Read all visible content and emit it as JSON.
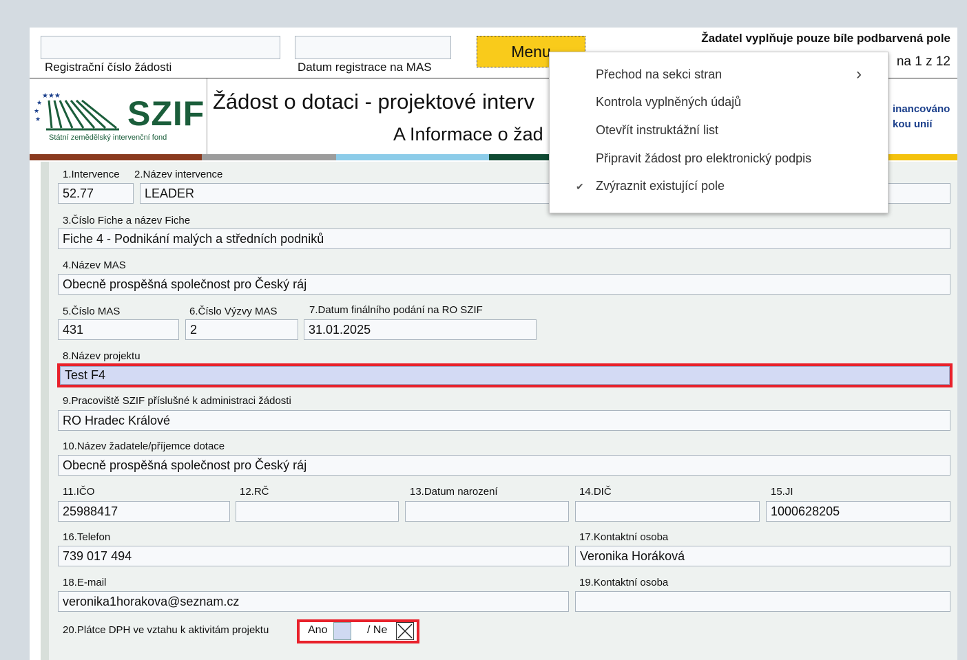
{
  "header": {
    "reg_number_label": "Registrační číslo žádosti",
    "reg_date_label": "Datum registrace na MAS",
    "menu_label": "Menu",
    "instruction": "Žadatel vyplňuje pouze bíle podbarvená pole",
    "page_info": "na 1 z 12",
    "logo_text": "SZIF",
    "logo_subtitle": "Státní zemědělský intervenční fond",
    "title": "Žádost o dotaci - projektové interv",
    "section_title": "A Informace o žad",
    "eu_line1": "inancováno",
    "eu_line2": "kou unií"
  },
  "menu": {
    "items": [
      {
        "label": "Přechod na sekci stran",
        "submenu_icon": "chevron-right"
      },
      {
        "label": "Kontrola vyplněných údajů"
      },
      {
        "label": "Otevřít instruktážní list"
      },
      {
        "label": "Připravit žádost pro elektronický podpis"
      },
      {
        "label": "Zvýraznit existující pole",
        "checked": true
      }
    ],
    "check_mark": "✔",
    "chevron": "›"
  },
  "form": {
    "f1_label": "1.Intervence",
    "f1_value": "52.77",
    "f2_label": "2.Název intervence",
    "f2_value": "LEADER",
    "f3_label": "3.Číslo Fiche a název Fiche",
    "f3_value": "Fiche 4 - Podnikání malých a středních podniků",
    "f4_label": "4.Název MAS",
    "f4_value": "Obecně prospěšná společnost pro Český ráj",
    "f5_label": "5.Číslo MAS",
    "f5_value": "431",
    "f6_label": "6.Číslo Výzvy MAS",
    "f6_value": "2",
    "f7_label": "7.Datum finálního podání na RO SZIF",
    "f7_value": "31.01.2025",
    "f8_label": "8.Název projektu",
    "f8_value": "Test F4",
    "f9_label": "9.Pracoviště SZIF příslušné k administraci žádosti",
    "f9_value": "RO Hradec Králové",
    "f10_label": "10.Název žadatele/příjemce dotace",
    "f10_value": "Obecně prospěšná společnost pro Český ráj",
    "f11_label": "11.IČO",
    "f11_value": "25988417",
    "f12_label": "12.RČ",
    "f12_value": "",
    "f13_label": "13.Datum narození",
    "f13_value": "",
    "f14_label": "14.DIČ",
    "f14_value": "",
    "f15_label": "15.JI",
    "f15_value": "1000628205",
    "f16_label": "16.Telefon",
    "f16_value": "739 017 494",
    "f17_label": "17.Kontaktní osoba",
    "f17_value": "Veronika Horáková",
    "f18_label": "18.E-mail",
    "f18_value": "veronika1horakova@seznam.cz",
    "f19_label": "19.Kontaktní osoba",
    "f19_value": "",
    "f20_label": "20.Plátce DPH ve vztahu k aktivitám projektu",
    "f20_yes": "Ano",
    "f20_no": "/ Ne"
  },
  "colors": {
    "highlight": "#e8212b",
    "menu_button": "#f9cb1b",
    "field_bg": "#f7f9fb",
    "selected_field_bg": "#d3daf4",
    "logo_green": "#1b5e3b"
  }
}
